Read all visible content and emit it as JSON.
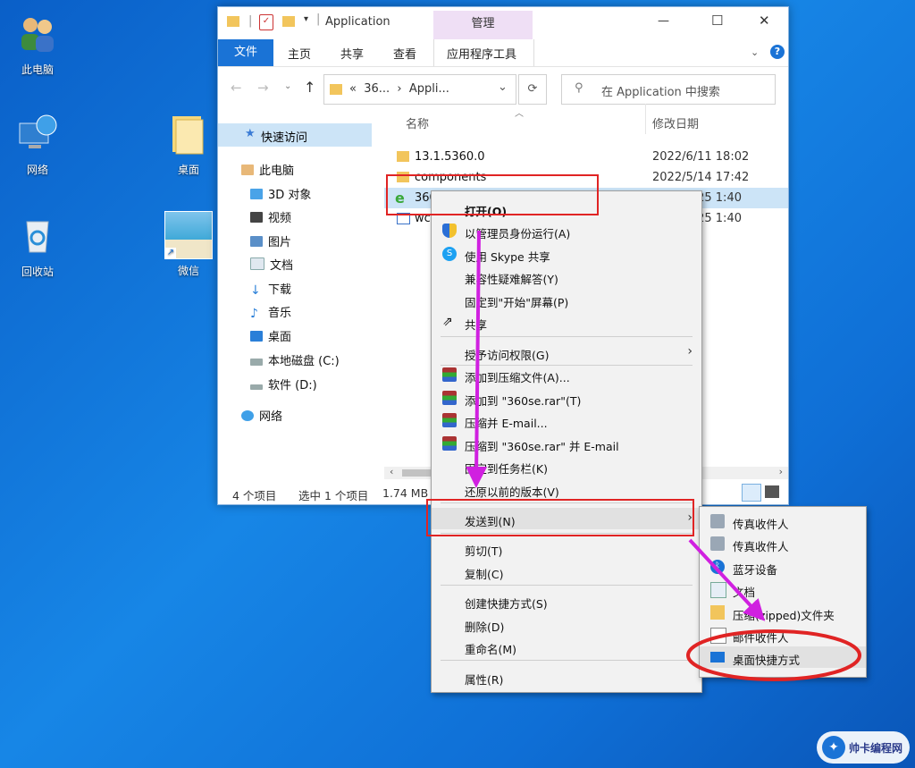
{
  "desktop": {
    "icons": [
      {
        "label": "此电脑",
        "icon": "users-icon"
      },
      {
        "label": "网络",
        "icon": "network-globe-icon"
      },
      {
        "label": "回收站",
        "icon": "recycle-bin-icon"
      },
      {
        "label": "桌面",
        "icon": "folder-icon"
      },
      {
        "label": "微信",
        "icon": "wechat-shortcut-icon"
      }
    ]
  },
  "window": {
    "title": "Application",
    "context_tab_group": "管理",
    "controls": {
      "minimize": "—",
      "maximize": "☐",
      "close": "✕"
    },
    "ribbon_tabs": [
      "文件",
      "主页",
      "共享",
      "查看",
      "应用程序工具"
    ],
    "path": "«  36...  ›  Appli...",
    "search_placeholder": "在 Application 中搜索",
    "columns": {
      "name": "名称",
      "date": "修改日期"
    },
    "nav": {
      "quick_access": "快速访问",
      "this_pc": "此电脑",
      "items": [
        "3D 对象",
        "视频",
        "图片",
        "文档",
        "下载",
        "音乐",
        "桌面",
        "本地磁盘 (C:)",
        "软件 (D:)"
      ],
      "network": "网络"
    },
    "files": [
      {
        "name": "13.1.5360.0",
        "date": "2022/6/11 18:02"
      },
      {
        "name": "components",
        "date": "2022/5/14 17:42"
      },
      {
        "name": "360se.exe",
        "date": "2022/4/25 1:40"
      },
      {
        "name": "wc",
        "date": "2022/4/25 1:40"
      }
    ],
    "status": {
      "count": "4 个项目",
      "selected": "选中 1 个项目",
      "size": "1.74 MB"
    }
  },
  "context_menu": {
    "items": [
      {
        "label": "打开(O)",
        "bold": true
      },
      {
        "label": "以管理员身份运行(A)",
        "icon": "shield-icon"
      },
      {
        "label": "使用 Skype 共享",
        "icon": "skype-icon"
      },
      {
        "label": "兼容性疑难解答(Y)"
      },
      {
        "label": "固定到\"开始\"屏幕(P)"
      },
      {
        "label": "共享",
        "icon": "share-icon"
      },
      {
        "label": "授予访问权限(G)",
        "submenu": true
      },
      {
        "label": "添加到压缩文件(A)...",
        "icon": "winrar-icon"
      },
      {
        "label": "添加到 \"360se.rar\"(T)",
        "icon": "winrar-icon"
      },
      {
        "label": "压缩并 E-mail...",
        "icon": "winrar-icon"
      },
      {
        "label": "压缩到 \"360se.rar\" 并 E-mail",
        "icon": "winrar-icon"
      },
      {
        "label": "固定到任务栏(K)"
      },
      {
        "label": "还原以前的版本(V)"
      },
      {
        "label": "发送到(N)",
        "submenu": true
      },
      {
        "label": "剪切(T)"
      },
      {
        "label": "复制(C)"
      },
      {
        "label": "创建快捷方式(S)"
      },
      {
        "label": "删除(D)"
      },
      {
        "label": "重命名(M)"
      },
      {
        "label": "属性(R)"
      }
    ]
  },
  "sendto_menu": {
    "items": [
      {
        "label": "传真收件人",
        "icon": "fax-icon"
      },
      {
        "label": "传真收件人",
        "icon": "fax-icon"
      },
      {
        "label": "蓝牙设备",
        "icon": "bluetooth-icon"
      },
      {
        "label": "文档",
        "icon": "document-icon"
      },
      {
        "label": "压缩(zipped)文件夹",
        "icon": "zip-folder-icon"
      },
      {
        "label": "邮件收件人",
        "icon": "mail-icon"
      },
      {
        "label": "桌面快捷方式",
        "icon": "desktop-icon"
      }
    ]
  },
  "watermark": {
    "text": "帅卡编程网"
  },
  "colors": {
    "annotation_red": "#e02424",
    "annotation_arrow": "#d020e0",
    "accent": "#1a73d6"
  }
}
